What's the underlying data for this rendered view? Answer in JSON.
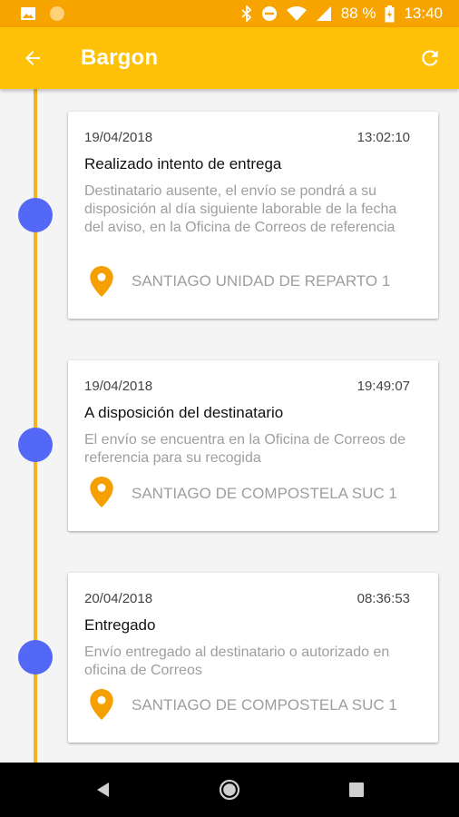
{
  "status_bar": {
    "battery_percent": "88 %",
    "time": "13:40",
    "icons": [
      "image-icon",
      "circle-icon",
      "bluetooth-icon",
      "do-not-disturb-icon",
      "wifi-icon",
      "signal-icon",
      "battery-icon"
    ]
  },
  "app_bar": {
    "title": "Bargon",
    "back_icon": "arrow-back-icon",
    "refresh_icon": "refresh-icon"
  },
  "colors": {
    "status_bar": "#f7a400",
    "app_bar": "#ffc107",
    "timeline_line": "#f2b51b",
    "timeline_dot": "#5468f7",
    "location_pin": "#f5a000"
  },
  "events": [
    {
      "date": "19/04/2018",
      "time": "13:02:10",
      "title": "Realizado intento de entrega",
      "description": "Destinatario ausente, el envío se pondrá a su disposición al día siguiente laborable de la fecha del aviso, en la Oficina de Correos de referencia",
      "location": "SANTIAGO UNIDAD DE REPARTO 1"
    },
    {
      "date": "19/04/2018",
      "time": "19:49:07",
      "title": "A disposición del destinatario",
      "description": "El envío se encuentra en la Oficina de Correos de referencia para su recogida",
      "location": "SANTIAGO DE COMPOSTELA SUC 1"
    },
    {
      "date": "20/04/2018",
      "time": "08:36:53",
      "title": "Entregado",
      "description": "Envío entregado al destinatario o autorizado en oficina de Correos",
      "location": "SANTIAGO DE COMPOSTELA SUC 1"
    }
  ],
  "nav_bar": {
    "icons": [
      "nav-back-icon",
      "nav-home-icon",
      "nav-recent-icon"
    ]
  }
}
